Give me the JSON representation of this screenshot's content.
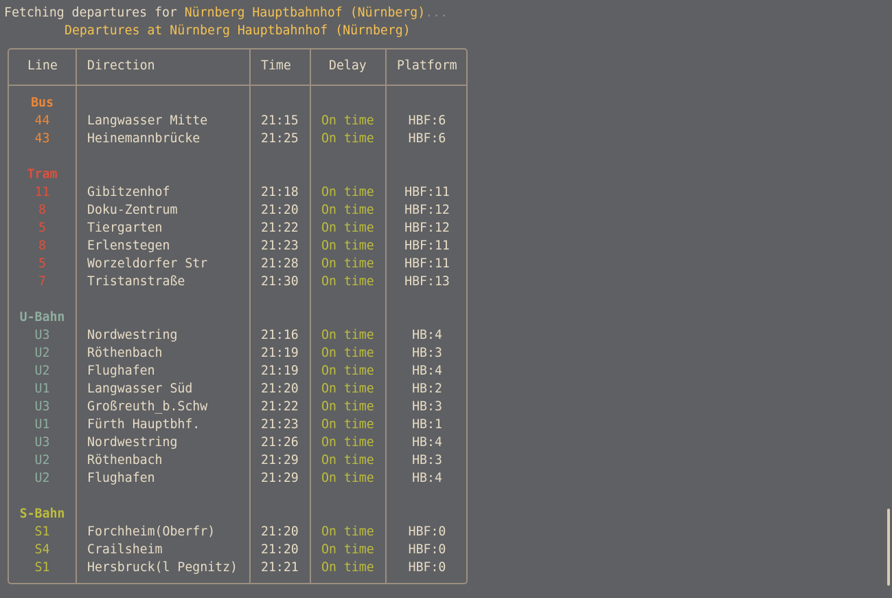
{
  "status": {
    "prefix": "Fetching departures for ",
    "station": "Nürnberg Hauptbahnhof (Nürnberg)",
    "ellipsis": "..."
  },
  "title": "Departures at Nürnberg Hauptbahnhof (Nürnberg)",
  "columns": [
    "Line",
    "Direction",
    "Time",
    "Delay",
    "Platform"
  ],
  "groups": [
    {
      "name": "Bus",
      "color": "#ef8736",
      "rows": [
        {
          "line": "44",
          "direction": "Langwasser Mitte",
          "time": "21:15",
          "delay": "On time",
          "platform": "HBF:6"
        },
        {
          "line": "43",
          "direction": "Heinemannbrücke",
          "time": "21:25",
          "delay": "On time",
          "platform": "HBF:6"
        }
      ]
    },
    {
      "name": "Tram",
      "color": "#e0503d",
      "rows": [
        {
          "line": "11",
          "direction": "Gibitzenhof",
          "time": "21:18",
          "delay": "On time",
          "platform": "HBF:11"
        },
        {
          "line": "8",
          "direction": "Doku-Zentrum",
          "time": "21:20",
          "delay": "On time",
          "platform": "HBF:12"
        },
        {
          "line": "5",
          "direction": "Tiergarten",
          "time": "21:22",
          "delay": "On time",
          "platform": "HBF:12"
        },
        {
          "line": "8",
          "direction": "Erlenstegen",
          "time": "21:23",
          "delay": "On time",
          "platform": "HBF:11"
        },
        {
          "line": "5",
          "direction": "Worzeldorfer Str",
          "time": "21:28",
          "delay": "On time",
          "platform": "HBF:11"
        },
        {
          "line": "7",
          "direction": "Tristanstraße",
          "time": "21:30",
          "delay": "On time",
          "platform": "HBF:13"
        }
      ]
    },
    {
      "name": "U-Bahn",
      "color": "#8fafa0",
      "rows": [
        {
          "line": "U3",
          "direction": "Nordwestring",
          "time": "21:16",
          "delay": "On time",
          "platform": "HB:4"
        },
        {
          "line": "U2",
          "direction": "Röthenbach",
          "time": "21:19",
          "delay": "On time",
          "platform": "HB:3"
        },
        {
          "line": "U2",
          "direction": "Flughafen",
          "time": "21:19",
          "delay": "On time",
          "platform": "HB:4"
        },
        {
          "line": "U1",
          "direction": "Langwasser Süd",
          "time": "21:20",
          "delay": "On time",
          "platform": "HB:2"
        },
        {
          "line": "U3",
          "direction": "Großreuth_b.Schw",
          "time": "21:22",
          "delay": "On time",
          "platform": "HB:3"
        },
        {
          "line": "U1",
          "direction": "Fürth Hauptbhf.",
          "time": "21:23",
          "delay": "On time",
          "platform": "HB:1"
        },
        {
          "line": "U3",
          "direction": "Nordwestring",
          "time": "21:26",
          "delay": "On time",
          "platform": "HB:4"
        },
        {
          "line": "U2",
          "direction": "Röthenbach",
          "time": "21:29",
          "delay": "On time",
          "platform": "HB:3"
        },
        {
          "line": "U2",
          "direction": "Flughafen",
          "time": "21:29",
          "delay": "On time",
          "platform": "HB:4"
        }
      ]
    },
    {
      "name": "S-Bahn",
      "color": "#bdbd3d",
      "rows": [
        {
          "line": "S1",
          "direction": "Forchheim(Oberfr)",
          "time": "21:20",
          "delay": "On time",
          "platform": "HBF:0"
        },
        {
          "line": "S4",
          "direction": "Crailsheim",
          "time": "21:20",
          "delay": "On time",
          "platform": "HBF:0"
        },
        {
          "line": "S1",
          "direction": "Hersbruck(l Pegnitz)",
          "time": "21:21",
          "delay": "On time",
          "platform": "HBF:0"
        }
      ]
    }
  ]
}
